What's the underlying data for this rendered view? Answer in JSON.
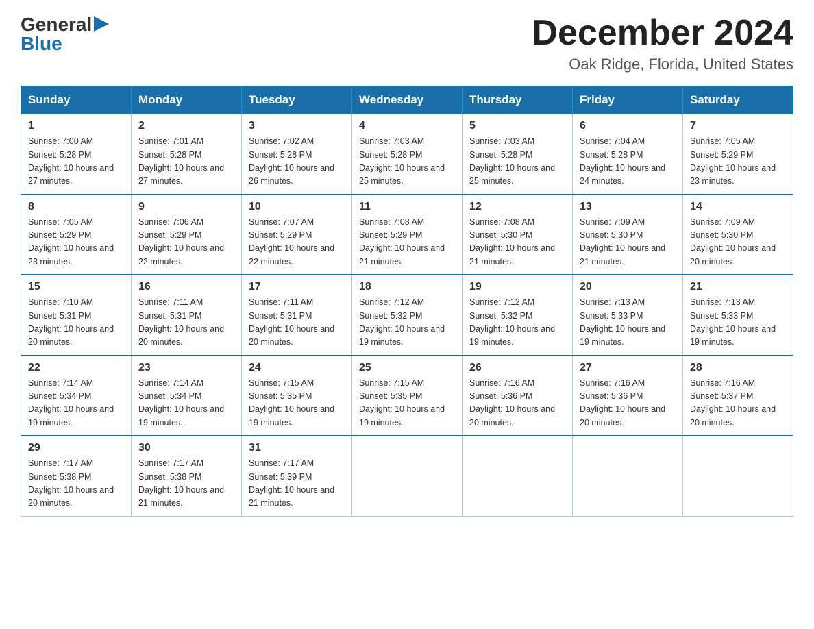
{
  "header": {
    "logo_general": "General",
    "logo_blue": "Blue",
    "month_title": "December 2024",
    "location": "Oak Ridge, Florida, United States"
  },
  "days_of_week": [
    "Sunday",
    "Monday",
    "Tuesday",
    "Wednesday",
    "Thursday",
    "Friday",
    "Saturday"
  ],
  "weeks": [
    [
      {
        "day": "1",
        "sunrise": "7:00 AM",
        "sunset": "5:28 PM",
        "daylight": "10 hours and 27 minutes."
      },
      {
        "day": "2",
        "sunrise": "7:01 AM",
        "sunset": "5:28 PM",
        "daylight": "10 hours and 27 minutes."
      },
      {
        "day": "3",
        "sunrise": "7:02 AM",
        "sunset": "5:28 PM",
        "daylight": "10 hours and 26 minutes."
      },
      {
        "day": "4",
        "sunrise": "7:03 AM",
        "sunset": "5:28 PM",
        "daylight": "10 hours and 25 minutes."
      },
      {
        "day": "5",
        "sunrise": "7:03 AM",
        "sunset": "5:28 PM",
        "daylight": "10 hours and 25 minutes."
      },
      {
        "day": "6",
        "sunrise": "7:04 AM",
        "sunset": "5:28 PM",
        "daylight": "10 hours and 24 minutes."
      },
      {
        "day": "7",
        "sunrise": "7:05 AM",
        "sunset": "5:29 PM",
        "daylight": "10 hours and 23 minutes."
      }
    ],
    [
      {
        "day": "8",
        "sunrise": "7:05 AM",
        "sunset": "5:29 PM",
        "daylight": "10 hours and 23 minutes."
      },
      {
        "day": "9",
        "sunrise": "7:06 AM",
        "sunset": "5:29 PM",
        "daylight": "10 hours and 22 minutes."
      },
      {
        "day": "10",
        "sunrise": "7:07 AM",
        "sunset": "5:29 PM",
        "daylight": "10 hours and 22 minutes."
      },
      {
        "day": "11",
        "sunrise": "7:08 AM",
        "sunset": "5:29 PM",
        "daylight": "10 hours and 21 minutes."
      },
      {
        "day": "12",
        "sunrise": "7:08 AM",
        "sunset": "5:30 PM",
        "daylight": "10 hours and 21 minutes."
      },
      {
        "day": "13",
        "sunrise": "7:09 AM",
        "sunset": "5:30 PM",
        "daylight": "10 hours and 21 minutes."
      },
      {
        "day": "14",
        "sunrise": "7:09 AM",
        "sunset": "5:30 PM",
        "daylight": "10 hours and 20 minutes."
      }
    ],
    [
      {
        "day": "15",
        "sunrise": "7:10 AM",
        "sunset": "5:31 PM",
        "daylight": "10 hours and 20 minutes."
      },
      {
        "day": "16",
        "sunrise": "7:11 AM",
        "sunset": "5:31 PM",
        "daylight": "10 hours and 20 minutes."
      },
      {
        "day": "17",
        "sunrise": "7:11 AM",
        "sunset": "5:31 PM",
        "daylight": "10 hours and 20 minutes."
      },
      {
        "day": "18",
        "sunrise": "7:12 AM",
        "sunset": "5:32 PM",
        "daylight": "10 hours and 19 minutes."
      },
      {
        "day": "19",
        "sunrise": "7:12 AM",
        "sunset": "5:32 PM",
        "daylight": "10 hours and 19 minutes."
      },
      {
        "day": "20",
        "sunrise": "7:13 AM",
        "sunset": "5:33 PM",
        "daylight": "10 hours and 19 minutes."
      },
      {
        "day": "21",
        "sunrise": "7:13 AM",
        "sunset": "5:33 PM",
        "daylight": "10 hours and 19 minutes."
      }
    ],
    [
      {
        "day": "22",
        "sunrise": "7:14 AM",
        "sunset": "5:34 PM",
        "daylight": "10 hours and 19 minutes."
      },
      {
        "day": "23",
        "sunrise": "7:14 AM",
        "sunset": "5:34 PM",
        "daylight": "10 hours and 19 minutes."
      },
      {
        "day": "24",
        "sunrise": "7:15 AM",
        "sunset": "5:35 PM",
        "daylight": "10 hours and 19 minutes."
      },
      {
        "day": "25",
        "sunrise": "7:15 AM",
        "sunset": "5:35 PM",
        "daylight": "10 hours and 19 minutes."
      },
      {
        "day": "26",
        "sunrise": "7:16 AM",
        "sunset": "5:36 PM",
        "daylight": "10 hours and 20 minutes."
      },
      {
        "day": "27",
        "sunrise": "7:16 AM",
        "sunset": "5:36 PM",
        "daylight": "10 hours and 20 minutes."
      },
      {
        "day": "28",
        "sunrise": "7:16 AM",
        "sunset": "5:37 PM",
        "daylight": "10 hours and 20 minutes."
      }
    ],
    [
      {
        "day": "29",
        "sunrise": "7:17 AM",
        "sunset": "5:38 PM",
        "daylight": "10 hours and 20 minutes."
      },
      {
        "day": "30",
        "sunrise": "7:17 AM",
        "sunset": "5:38 PM",
        "daylight": "10 hours and 21 minutes."
      },
      {
        "day": "31",
        "sunrise": "7:17 AM",
        "sunset": "5:39 PM",
        "daylight": "10 hours and 21 minutes."
      },
      null,
      null,
      null,
      null
    ]
  ],
  "labels": {
    "sunrise": "Sunrise:",
    "sunset": "Sunset:",
    "daylight": "Daylight:"
  }
}
